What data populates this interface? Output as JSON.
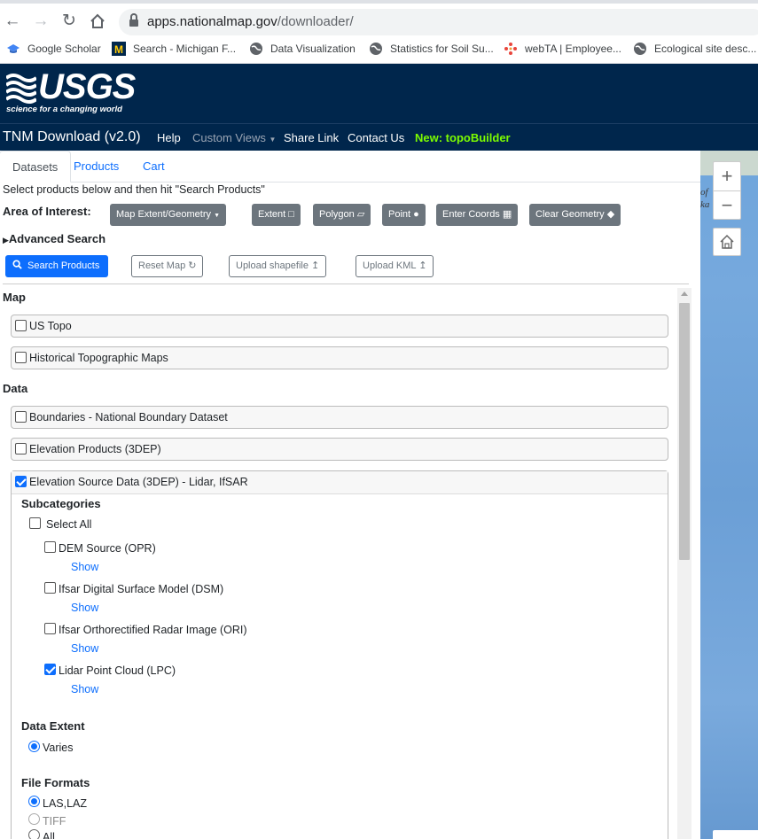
{
  "browser": {
    "url_host": "apps.nationalmap.gov",
    "url_path": "/downloader/",
    "bookmarks": [
      {
        "label": "Google Scholar",
        "icon": "graduation-cap-icon"
      },
      {
        "label": "Search - Michigan F...",
        "icon": "michigan-m-icon"
      },
      {
        "label": "Data Visualization",
        "icon": "globe-icon"
      },
      {
        "label": "Statistics for Soil Su...",
        "icon": "globe-icon"
      },
      {
        "label": "webTA | Employee...",
        "icon": "dots-icon"
      },
      {
        "label": "Ecological site desc...",
        "icon": "globe-icon"
      }
    ]
  },
  "header": {
    "logo_text": "USGS",
    "logo_tagline": "science for a changing world"
  },
  "nav": {
    "brand": "TNM Download (v2.0)",
    "help": "Help",
    "custom_views": "Custom Views",
    "share_link": "Share Link",
    "contact_us": "Contact Us",
    "topobuilder": "New: topoBuilder"
  },
  "tabs": [
    "Datasets",
    "Products",
    "Cart"
  ],
  "instructions": "Select products below and then hit \"Search Products\"",
  "aoi": {
    "label": "Area of Interest:",
    "buttons": [
      "Map Extent/Geometry",
      "Extent",
      "Polygon",
      "Point",
      "Enter Coords",
      "Clear Geometry"
    ]
  },
  "advanced_search": "Advanced Search",
  "actions": {
    "search": "Search Products",
    "reset": "Reset Map",
    "upload_shapefile": "Upload shapefile",
    "upload_kml": "Upload KML"
  },
  "sections": {
    "map": "Map",
    "data": "Data"
  },
  "map_categories": [
    {
      "label": "US Topo",
      "checked": false
    },
    {
      "label": "Historical Topographic Maps",
      "checked": false
    }
  ],
  "data_categories": [
    {
      "label": "Boundaries - National Boundary Dataset",
      "checked": false
    },
    {
      "label": "Elevation Products (3DEP)",
      "checked": false
    }
  ],
  "expanded": {
    "label": "Elevation Source Data (3DEP) - Lidar, IfSAR",
    "checked": true,
    "subcategories_title": "Subcategories",
    "select_all": "Select All",
    "show_label": "Show",
    "subcategories": [
      {
        "label": "DEM Source (OPR)",
        "checked": false
      },
      {
        "label": "Ifsar Digital Surface Model (DSM)",
        "checked": false
      },
      {
        "label": "Ifsar Orthorectified Radar Image (ORI)",
        "checked": false
      },
      {
        "label": "Lidar Point Cloud (LPC)",
        "checked": true
      }
    ],
    "data_extent_title": "Data Extent",
    "data_extent_options": [
      {
        "label": "Varies",
        "selected": true
      }
    ],
    "file_formats_title": "File Formats",
    "file_format_options": [
      {
        "label": "LAS,LAZ",
        "selected": true
      },
      {
        "label": "TIFF",
        "selected": false
      },
      {
        "label": "All",
        "selected": false
      }
    ]
  },
  "map_panel": {
    "label_lines": [
      "of",
      "ka"
    ]
  }
}
